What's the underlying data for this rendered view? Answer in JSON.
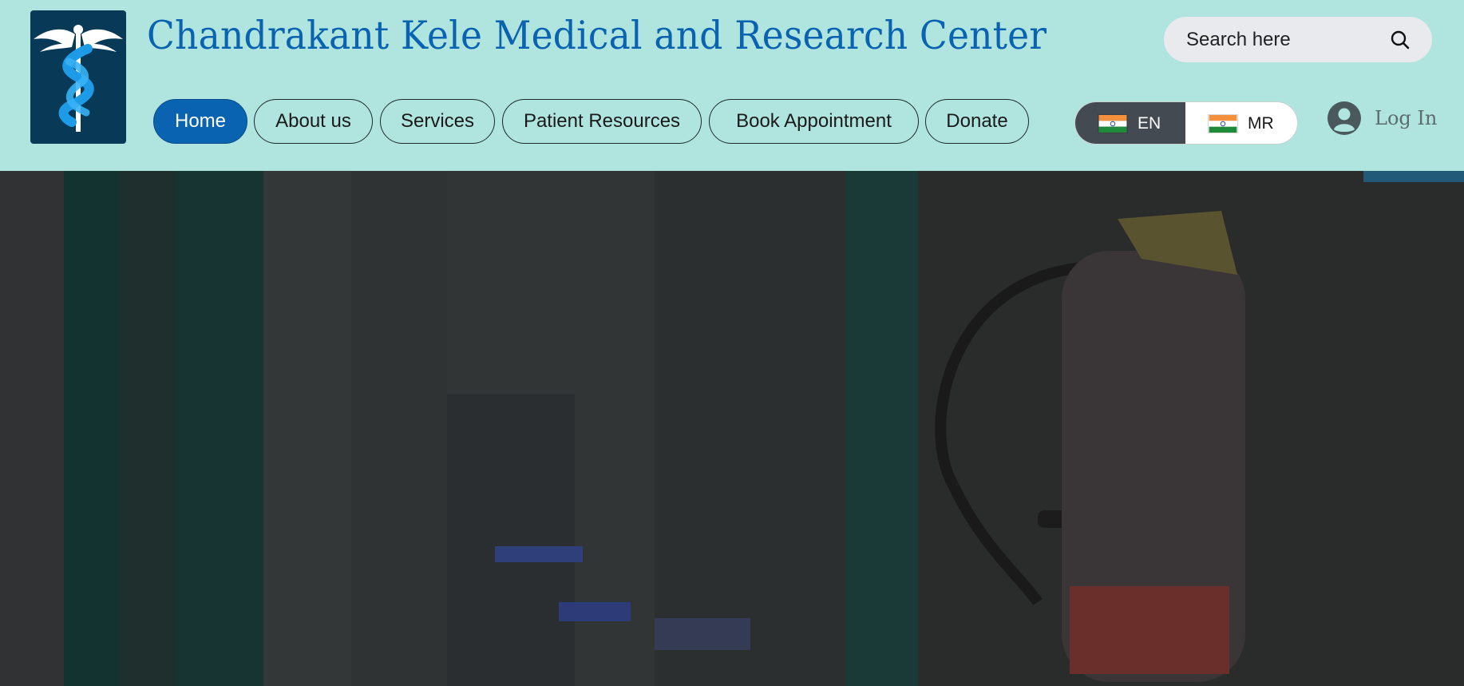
{
  "site": {
    "title": "Chandrakant Kele Medical and Research Center",
    "logo_icon": "caduceus-icon"
  },
  "nav": {
    "items": [
      {
        "label": "Home",
        "active": true
      },
      {
        "label": "About us"
      },
      {
        "label": "Services"
      },
      {
        "label": "Patient Resources"
      },
      {
        "label": "Book Appointment"
      },
      {
        "label": "Donate"
      }
    ]
  },
  "search": {
    "placeholder": "Search here",
    "icon": "search-icon"
  },
  "language": {
    "selected": "EN",
    "other": "MR",
    "flag_icon": "india-flag-icon"
  },
  "login": {
    "label": "Log In",
    "icon": "avatar-icon"
  },
  "colors": {
    "header_bg": "#b0e4de",
    "brand": "#0a63b0",
    "logo_bg": "#083957"
  }
}
